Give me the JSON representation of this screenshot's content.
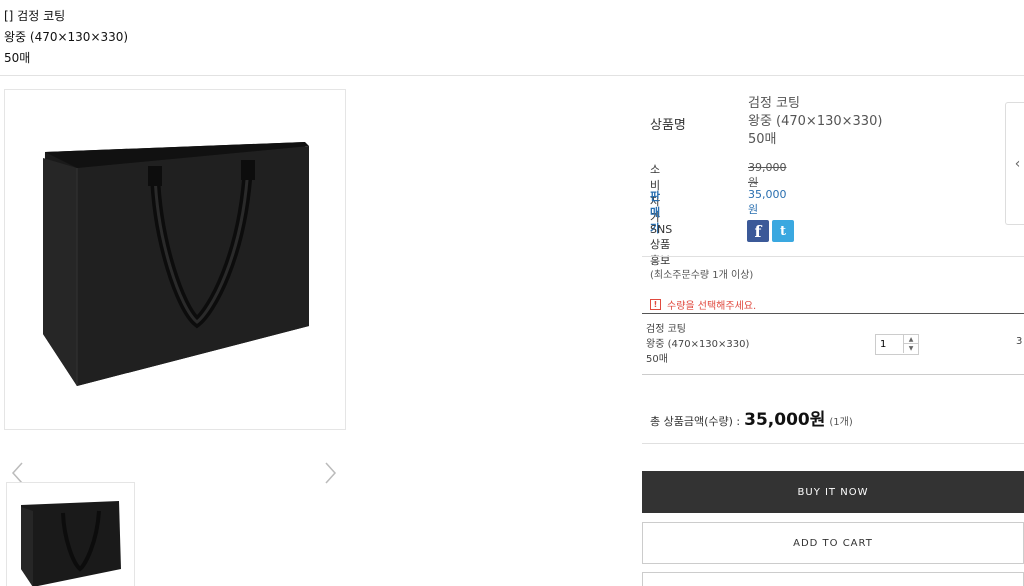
{
  "product": {
    "title_line1": "[] 검정 코팅",
    "title_line2": "왕중 (470×130×330)",
    "title_line3": "50매",
    "name_label": "상품명",
    "name_line1": "검정 코팅",
    "name_line2": "왕중 (470×130×330)",
    "name_line3": "50매"
  },
  "price": {
    "consumer_label": "소비자가",
    "consumer_value": "39,000원",
    "sale_label": "판매가",
    "sale_value": "35,000원",
    "sns_label": "SNS 상품홍보"
  },
  "sns": {
    "facebook_glyph": "f",
    "twitter_glyph": "t"
  },
  "order": {
    "min_qty_text": "(최소주문수량 1개 이상)",
    "warn_glyph": "!",
    "warning_text": "수량을 선택해주세요.",
    "option_line1": "검정 코팅",
    "option_line2": "왕중 (470×130×330)",
    "option_line3": "50매",
    "quantity": "1",
    "qty_up": "▲",
    "qty_down": "▼",
    "trailing_text": "3"
  },
  "total": {
    "label": "총 상품금액(수량) :",
    "amount": "35,000원",
    "count": "(1개)"
  },
  "buttons": {
    "buy_now": "BUY IT NOW",
    "add_to_cart": "ADD TO CART"
  },
  "side_tab": {
    "glyph": "‹"
  },
  "icons": {
    "gallery_prev": "chevron-left-icon",
    "gallery_next": "chevron-right-icon",
    "facebook": "facebook-icon",
    "twitter": "twitter-icon",
    "warning": "warning-icon"
  },
  "colors": {
    "sale_blue": "#2a6fb0",
    "warning_red": "#e04a3f",
    "buy_button_bg": "#333333"
  }
}
